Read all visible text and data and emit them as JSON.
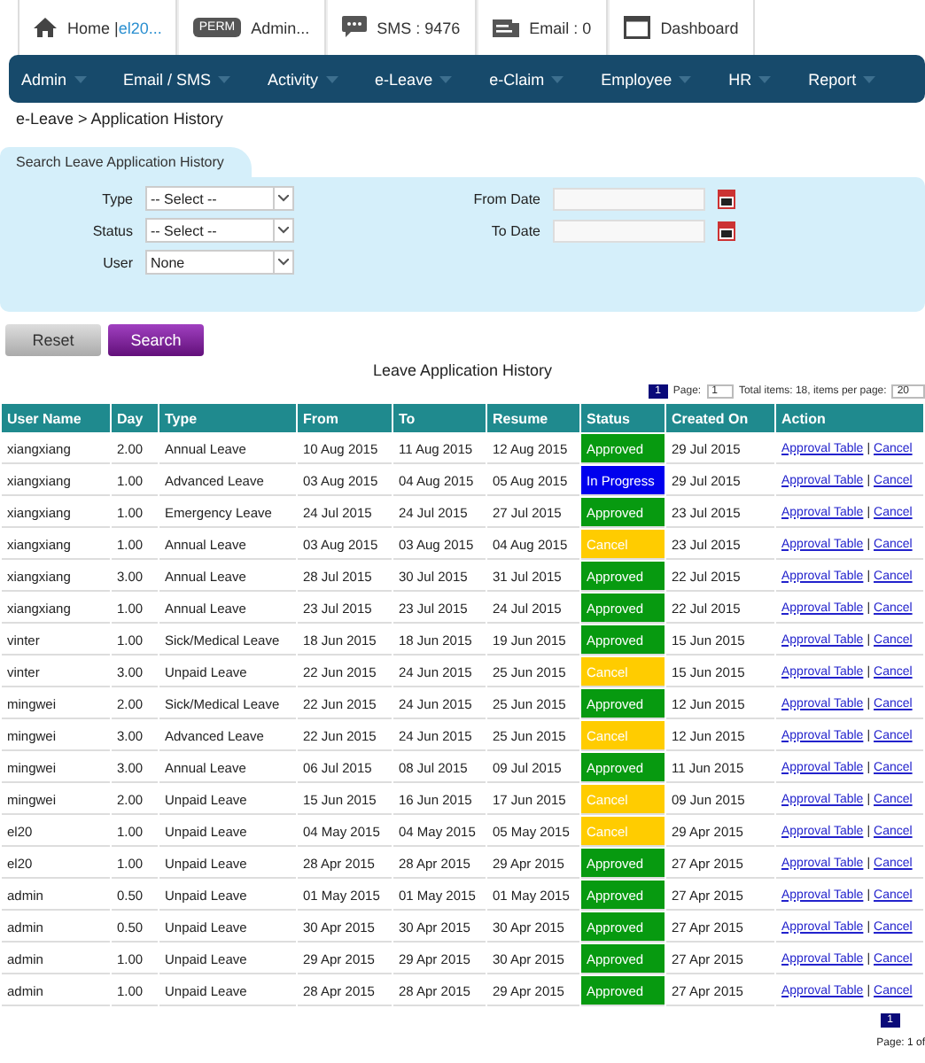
{
  "topbar": [
    {
      "kind": "home",
      "label": "Home |",
      "user": "el20..."
    },
    {
      "kind": "perm",
      "badge": "PERM",
      "label": "Admin..."
    },
    {
      "kind": "sms",
      "label": "SMS : 9476"
    },
    {
      "kind": "email",
      "label": "Email : 0"
    },
    {
      "kind": "dashboard",
      "label": "Dashboard"
    }
  ],
  "menu": [
    "Admin",
    "Email / SMS",
    "Activity",
    "e-Leave",
    "e-Claim",
    "Employee",
    "HR",
    "Report"
  ],
  "breadcrumb": "e-Leave > Application History",
  "search": {
    "tab": "Search Leave Application History",
    "selects": [
      {
        "label": "Type",
        "value": "-- Select --"
      },
      {
        "label": "Status",
        "value": "-- Select --"
      },
      {
        "label": "User",
        "value": "None"
      }
    ],
    "dates": [
      {
        "label": "From Date"
      },
      {
        "label": "To Date"
      }
    ],
    "buttons": [
      "Reset",
      "Search"
    ]
  },
  "table": {
    "title": "Leave Application History",
    "pager": {
      "page": "1",
      "page_label": "Page:",
      "page_value": "1",
      "total": "Total items: 18, items per page:",
      "per_page": "20"
    },
    "columns": [
      "User Name",
      "Day",
      "Type",
      "From",
      "To",
      "Resume",
      "Status",
      "Created On",
      "Action"
    ],
    "rows": [
      {
        "user": "xiangxiang",
        "day": "2.00",
        "type": "Annual Leave",
        "from": "10 Aug 2015",
        "to": "11 Aug 2015",
        "resume": "12 Aug 2015",
        "status": {
          "text": "Approved",
          "kind": "ok"
        },
        "created": "29 Jul 2015",
        "actions": [
          "Approval Table",
          "|",
          "Cancel"
        ]
      },
      {
        "user": "xiangxiang",
        "day": "1.00",
        "type": "Advanced Leave",
        "from": "03 Aug 2015",
        "to": "04 Aug 2015",
        "resume": "05 Aug 2015",
        "status": {
          "text": "In Progress",
          "kind": "pending"
        },
        "created": "29 Jul 2015",
        "actions": [
          "Approval Table",
          "|",
          "Cancel"
        ]
      },
      {
        "user": "xiangxiang",
        "day": "1.00",
        "type": "Emergency Leave",
        "from": "24 Jul 2015",
        "to": "24 Jul 2015",
        "resume": "27 Jul 2015",
        "status": {
          "text": "Approved",
          "kind": "ok"
        },
        "created": "23 Jul 2015",
        "actions": [
          "Approval Table",
          "|",
          "Cancel"
        ]
      },
      {
        "user": "xiangxiang",
        "day": "1.00",
        "type": "Annual Leave",
        "from": "03 Aug 2015",
        "to": "03 Aug 2015",
        "resume": "04 Aug 2015",
        "status": {
          "text": "Cancel",
          "kind": "void"
        },
        "created": "23 Jul 2015",
        "actions": [
          "Approval Table",
          "|",
          "Cancel"
        ]
      },
      {
        "user": "xiangxiang",
        "day": "3.00",
        "type": "Annual Leave",
        "from": "28 Jul 2015",
        "to": "30 Jul 2015",
        "resume": "31 Jul 2015",
        "status": {
          "text": "Approved",
          "kind": "ok"
        },
        "created": "22 Jul 2015",
        "actions": [
          "Approval Table",
          "|",
          "Cancel"
        ]
      },
      {
        "user": "xiangxiang",
        "day": "1.00",
        "type": "Annual Leave",
        "from": "23 Jul 2015",
        "to": "23 Jul 2015",
        "resume": "24 Jul 2015",
        "status": {
          "text": "Approved",
          "kind": "ok"
        },
        "created": "22 Jul 2015",
        "actions": [
          "Approval Table",
          "|",
          "Cancel"
        ]
      },
      {
        "user": "vinter",
        "day": "1.00",
        "type": "Sick/Medical Leave",
        "from": "18 Jun 2015",
        "to": "18 Jun 2015",
        "resume": "19 Jun 2015",
        "status": {
          "text": "Approved",
          "kind": "ok"
        },
        "created": "15 Jun 2015",
        "actions": [
          "Approval Table",
          "|",
          "Cancel"
        ]
      },
      {
        "user": "vinter",
        "day": "3.00",
        "type": "Unpaid Leave",
        "from": "22 Jun 2015",
        "to": "24 Jun 2015",
        "resume": "25 Jun 2015",
        "status": {
          "text": "Cancel",
          "kind": "void"
        },
        "created": "15 Jun 2015",
        "actions": [
          "Approval Table",
          "|",
          "Cancel"
        ]
      },
      {
        "user": "mingwei",
        "day": "2.00",
        "type": "Sick/Medical Leave",
        "from": "22 Jun 2015",
        "to": "24 Jun 2015",
        "resume": "25 Jun 2015",
        "status": {
          "text": "Approved",
          "kind": "ok"
        },
        "created": "12 Jun 2015",
        "actions": [
          "Approval Table",
          "|",
          "Cancel"
        ]
      },
      {
        "user": "mingwei",
        "day": "3.00",
        "type": "Advanced Leave",
        "from": "22 Jun 2015",
        "to": "24 Jun 2015",
        "resume": "25 Jun 2015",
        "status": {
          "text": "Cancel",
          "kind": "void"
        },
        "created": "12 Jun 2015",
        "actions": [
          "Approval Table",
          "|",
          "Cancel"
        ]
      },
      {
        "user": "mingwei",
        "day": "3.00",
        "type": "Annual Leave",
        "from": "06 Jul 2015",
        "to": "08 Jul 2015",
        "resume": "09 Jul 2015",
        "status": {
          "text": "Approved",
          "kind": "ok"
        },
        "created": "11 Jun 2015",
        "actions": [
          "Approval Table",
          "|",
          "Cancel"
        ]
      },
      {
        "user": "mingwei",
        "day": "2.00",
        "type": "Unpaid Leave",
        "from": "15 Jun 2015",
        "to": "16 Jun 2015",
        "resume": "17 Jun 2015",
        "status": {
          "text": "Cancel",
          "kind": "void"
        },
        "created": "09 Jun 2015",
        "actions": [
          "Approval Table",
          "|",
          "Cancel"
        ]
      },
      {
        "user": "el20",
        "day": "1.00",
        "type": "Unpaid Leave",
        "from": "04 May 2015",
        "to": "04 May 2015",
        "resume": "05 May 2015",
        "status": {
          "text": "Cancel",
          "kind": "void"
        },
        "created": "29 Apr 2015",
        "actions": [
          "Approval Table",
          "|",
          "Cancel"
        ]
      },
      {
        "user": "el20",
        "day": "1.00",
        "type": "Unpaid Leave",
        "from": "28 Apr 2015",
        "to": "28 Apr 2015",
        "resume": "29 Apr 2015",
        "status": {
          "text": "Approved",
          "kind": "ok"
        },
        "created": "27 Apr 2015",
        "actions": [
          "Approval Table",
          "|",
          "Cancel"
        ]
      },
      {
        "user": "admin",
        "day": "0.50",
        "type": "Unpaid Leave",
        "from": "01 May 2015",
        "to": "01 May 2015",
        "resume": "01 May 2015",
        "status": {
          "text": "Approved",
          "kind": "ok"
        },
        "created": "27 Apr 2015",
        "actions": [
          "Approval Table",
          "|",
          "Cancel"
        ]
      },
      {
        "user": "admin",
        "day": "0.50",
        "type": "Unpaid Leave",
        "from": "30 Apr 2015",
        "to": "30 Apr 2015",
        "resume": "30 Apr 2015",
        "status": {
          "text": "Approved",
          "kind": "ok"
        },
        "created": "27 Apr 2015",
        "actions": [
          "Approval Table",
          "|",
          "Cancel"
        ]
      },
      {
        "user": "admin",
        "day": "1.00",
        "type": "Unpaid Leave",
        "from": "29 Apr 2015",
        "to": "29 Apr 2015",
        "resume": "30 Apr 2015",
        "status": {
          "text": "Approved",
          "kind": "ok"
        },
        "created": "27 Apr 2015",
        "actions": [
          "Approval Table",
          "|",
          "Cancel"
        ]
      },
      {
        "user": "admin",
        "day": "1.00",
        "type": "Unpaid Leave",
        "from": "28 Apr 2015",
        "to": "28 Apr 2015",
        "resume": "29 Apr 2015",
        "status": {
          "text": "Approved",
          "kind": "ok"
        },
        "created": "27 Apr 2015",
        "actions": [
          "Approval Table",
          "|",
          "Cancel"
        ]
      }
    ],
    "bottom_page": "1",
    "page_info": "Page: 1 of"
  }
}
